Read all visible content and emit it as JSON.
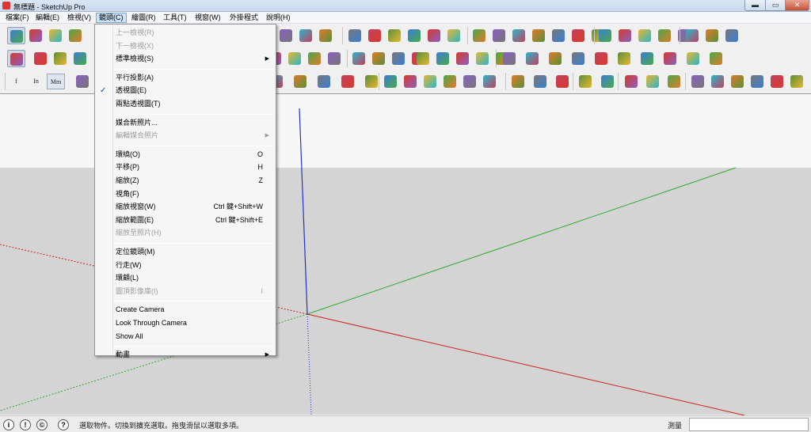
{
  "window": {
    "title": "無標題 - SketchUp Pro",
    "min_glyph": "▬",
    "max_glyph": "▭",
    "close_glyph": "✕"
  },
  "menubar": {
    "items": [
      "檔案(F)",
      "編輯(E)",
      "檢視(V)",
      "鏡頭(C)",
      "繪圖(R)",
      "工具(T)",
      "視窗(W)",
      "外掛程式",
      "說明(H)"
    ],
    "active_index": 3
  },
  "toolbar": {
    "text_buttons": [
      "f",
      "In",
      "Mm"
    ]
  },
  "camera_menu": {
    "items": [
      {
        "label": "上一檢視(R)",
        "disabled": true
      },
      {
        "label": "下一檢視(X)",
        "disabled": true
      },
      {
        "label": "標準檢視(S)",
        "submenu": true
      },
      {
        "sep": true
      },
      {
        "label": "平行投影(A)"
      },
      {
        "label": "透視圖(E)",
        "checked": true
      },
      {
        "label": "兩點透視圖(T)"
      },
      {
        "sep": true
      },
      {
        "label": "媒合新照片..."
      },
      {
        "label": "編輯媒合照片",
        "disabled": true,
        "submenu": true
      },
      {
        "sep": true
      },
      {
        "label": "環繞(O)",
        "shortcut": "O"
      },
      {
        "label": "平移(P)",
        "shortcut": "H"
      },
      {
        "label": "縮放(Z)",
        "shortcut": "Z"
      },
      {
        "label": "視角(F)"
      },
      {
        "label": "縮放視窗(W)",
        "shortcut": "Ctrl 鍵+Shift+W"
      },
      {
        "label": "縮放範圍(E)",
        "shortcut": "Ctrl 鍵+Shift+E"
      },
      {
        "label": "縮放至照片(H)",
        "disabled": true
      },
      {
        "sep": true
      },
      {
        "label": "定位鏡頭(M)"
      },
      {
        "label": "行走(W)"
      },
      {
        "label": "環顧(L)"
      },
      {
        "label": "圖頂影像庫(I)",
        "disabled": true,
        "shortcut": "I"
      },
      {
        "sep": true
      },
      {
        "label": "Create Camera"
      },
      {
        "label": "Look Through Camera"
      },
      {
        "label": "Show All"
      },
      {
        "sep": true
      },
      {
        "label": "動畫",
        "submenu": true
      }
    ],
    "check_glyph": "✓",
    "submenu_glyph": "▶"
  },
  "statusbar": {
    "icons": [
      "i",
      "!",
      "©",
      "?"
    ],
    "message": "選取物件。切換到擴充選取。拖曳滑鼠以選取多項。",
    "measure_label": "測量",
    "measure_value": ""
  },
  "colors": {
    "axis_red": "#cc2222",
    "axis_green": "#33aa33",
    "axis_blue": "#2233cc",
    "ground": "#d4d4d4",
    "sky": "#f7f7f7"
  }
}
